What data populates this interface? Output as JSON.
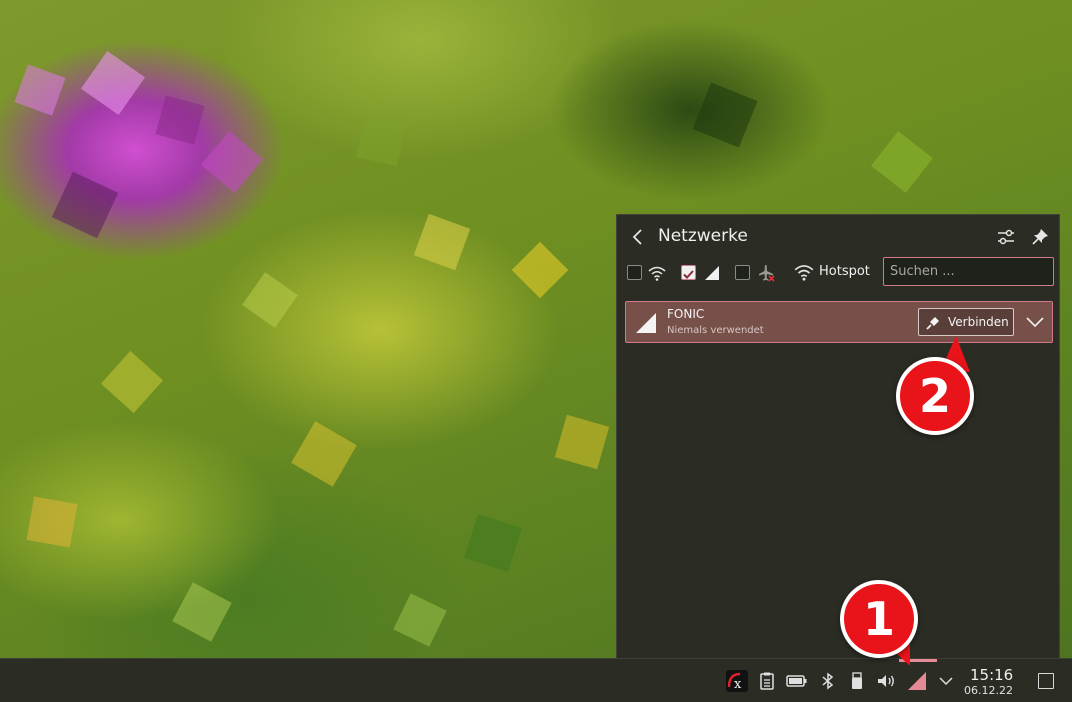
{
  "popup": {
    "title": "Netzwerke",
    "hotspot_label": "Hotspot",
    "search_placeholder": "Suchen ...",
    "filters": [
      {
        "name": "wifi",
        "checked": false
      },
      {
        "name": "mobile",
        "checked": true
      },
      {
        "name": "airplane",
        "checked": false
      }
    ]
  },
  "network": {
    "name": "FONIC",
    "status": "Niemals verwendet",
    "connect_label": "Verbinden"
  },
  "clock": {
    "time": "15:16",
    "date": "06.12.22"
  },
  "annotations": {
    "badge1": "1",
    "badge2": "2"
  },
  "colors": {
    "accent": "#d07a8a",
    "highlight_row": "#77504a",
    "panel": "#2b2d25",
    "badge": "#e8141a"
  }
}
